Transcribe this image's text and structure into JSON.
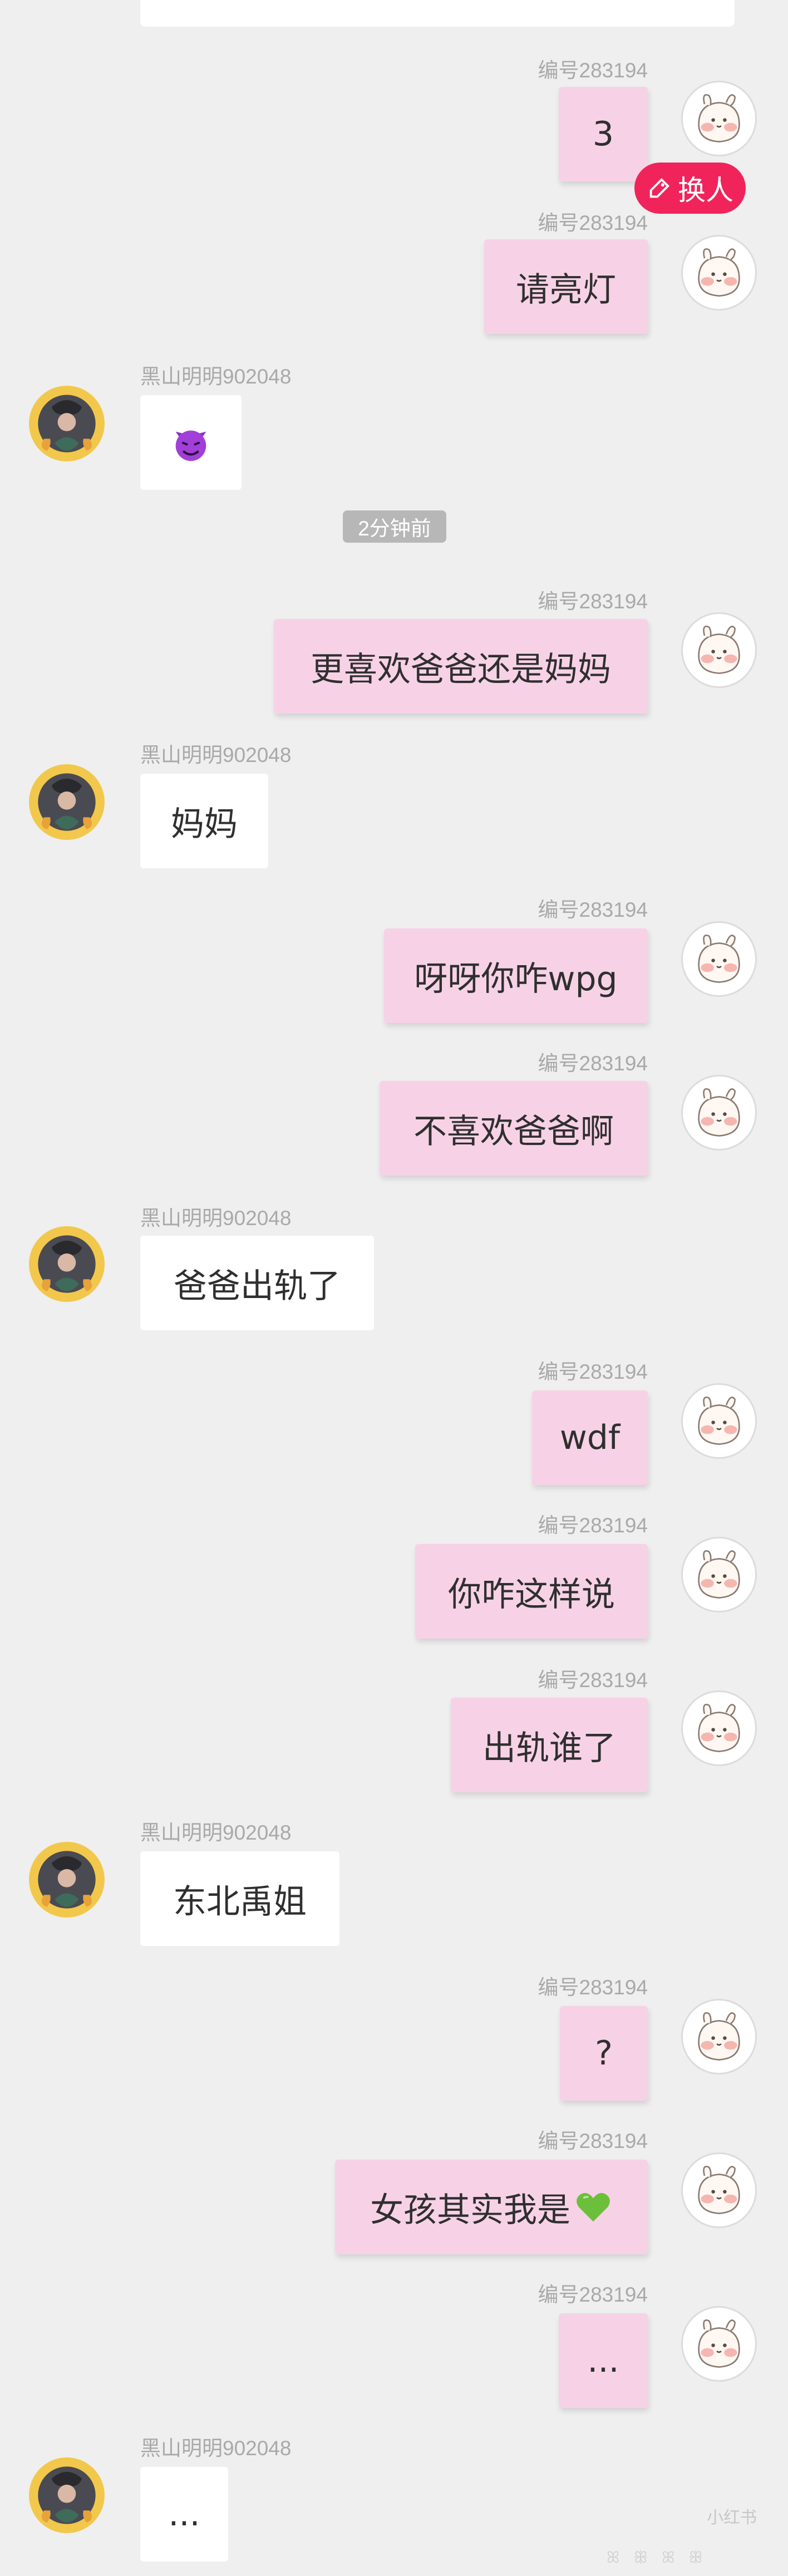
{
  "self_name": "编号283194",
  "other_name": "黑山明明902048",
  "timestamp": "2分钟前",
  "swap_button_label": "换人",
  "watermark": "小红书",
  "bottom_faint": "ꕤ ꕥ ꕤ ꕥ",
  "colors": {
    "background": "#efefef",
    "outgoing_bubble": "#f7d2e6",
    "incoming_bubble": "#ffffff",
    "swap_button": "#f0245a",
    "name_text": "#a9a9a9"
  },
  "messages": [
    {
      "side": "out",
      "text": "3"
    },
    {
      "side": "out",
      "text": "请亮灯"
    },
    {
      "side": "in",
      "text": "",
      "icon": "smiling-devil-emoji-icon"
    },
    {
      "side": "out",
      "text": "更喜欢爸爸还是妈妈"
    },
    {
      "side": "in",
      "text": "妈妈"
    },
    {
      "side": "out",
      "text": "呀呀你咋wpg"
    },
    {
      "side": "out",
      "text": "不喜欢爸爸啊"
    },
    {
      "side": "in",
      "text": "爸爸出轨了"
    },
    {
      "side": "out",
      "text": "wdf"
    },
    {
      "side": "out",
      "text": "你咋这样说"
    },
    {
      "side": "out",
      "text": "出轨谁了"
    },
    {
      "side": "in",
      "text": "东北禹姐"
    },
    {
      "side": "out",
      "text": "?"
    },
    {
      "side": "out",
      "text": "女孩其实我是",
      "icon": "green-heart-emoji-icon"
    },
    {
      "side": "out",
      "text": "..."
    },
    {
      "side": "in",
      "text": "..."
    }
  ]
}
